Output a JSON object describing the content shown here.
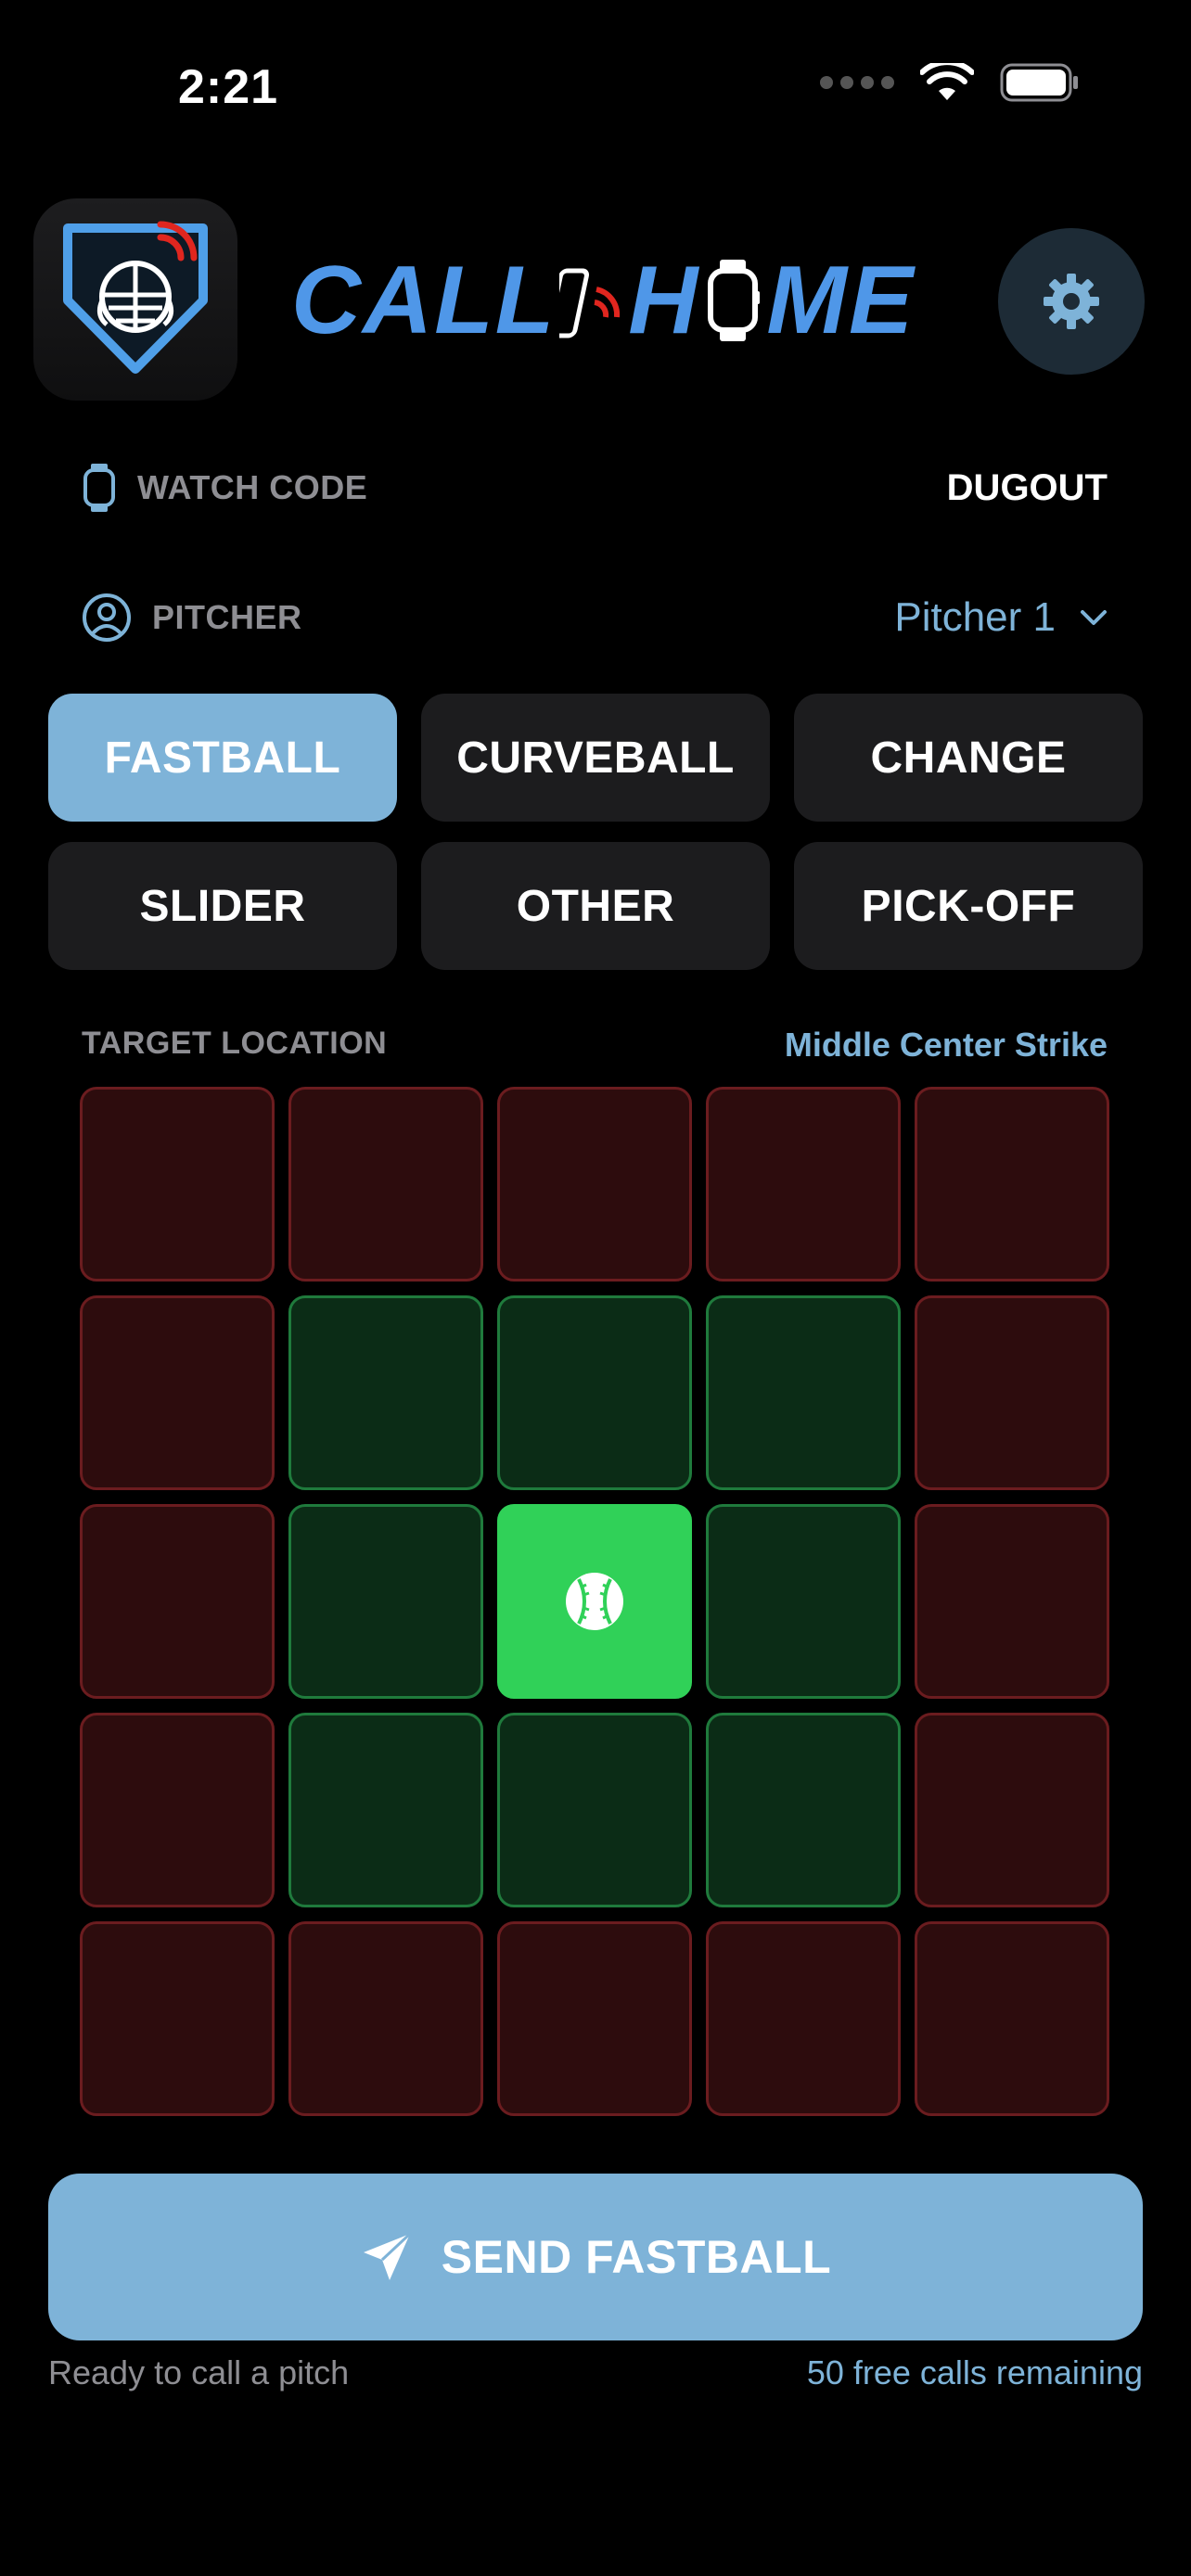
{
  "status_bar": {
    "time": "2:21",
    "icons": [
      "cellular-signal-icon",
      "wifi-icon",
      "battery-icon"
    ]
  },
  "header": {
    "brand": {
      "part1": "CALL",
      "part2": "H",
      "part3": "ME"
    },
    "icons": [
      "app-icon-catcher-mask",
      "phone-signal-icon",
      "watch-icon",
      "gear-icon"
    ]
  },
  "watch_code": {
    "label": "WATCH CODE",
    "value": "DUGOUT",
    "icon": "watch-icon"
  },
  "pitcher": {
    "label": "PITCHER",
    "value": "Pitcher 1",
    "icon": "person-circle-icon"
  },
  "pitches": [
    {
      "label": "FASTBALL",
      "selected": true
    },
    {
      "label": "CURVEBALL",
      "selected": false
    },
    {
      "label": "CHANGE",
      "selected": false
    },
    {
      "label": "SLIDER",
      "selected": false
    },
    {
      "label": "OTHER",
      "selected": false
    },
    {
      "label": "PICK-OFF",
      "selected": false
    }
  ],
  "target": {
    "label": "TARGET LOCATION",
    "value": "Middle Center Strike",
    "grid": [
      [
        "ball",
        "ball",
        "ball",
        "ball",
        "ball"
      ],
      [
        "ball",
        "strike",
        "strike",
        "strike",
        "ball"
      ],
      [
        "ball",
        "strike",
        "selected",
        "strike",
        "ball"
      ],
      [
        "ball",
        "strike",
        "strike",
        "strike",
        "ball"
      ],
      [
        "ball",
        "ball",
        "ball",
        "ball",
        "ball"
      ]
    ],
    "selected_icon": "baseball-icon"
  },
  "send": {
    "label": "SEND FASTBALL",
    "icon": "paper-plane-icon"
  },
  "footer": {
    "status": "Ready to call a pitch",
    "remaining": "50 free calls remaining"
  },
  "colors": {
    "accent": "#7eb3d8",
    "brand_blue": "#4f97e8",
    "signal_red": "#e0261f",
    "strike_green": "#30d158",
    "background": "#000000"
  }
}
